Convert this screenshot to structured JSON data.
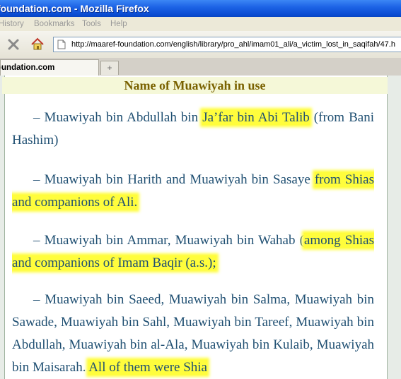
{
  "window": {
    "title": "foundation.com - Mozilla Firefox"
  },
  "menu": {
    "items": [
      "History",
      "Bookmarks",
      "Tools",
      "Help"
    ]
  },
  "toolbar": {
    "url": "http://maaref-foundation.com/english/library/pro_ahl/imam01_ali/a_victim_lost_in_saqifah/47.h",
    "stop_icon": "close-icon",
    "home_icon": "home-icon"
  },
  "tabs": {
    "active_label": "oundation.com",
    "new_tab_label": "+"
  },
  "content": {
    "heading": "Name of Muawiyah in use",
    "paragraphs": [
      {
        "before": "– Muawiyah bin Abdullah bin ",
        "highlight": "Ja’far bin Abi Talib",
        "after": " (from Bani Hashim)"
      },
      {
        "before": "– Muawiyah bin Harith and Muawiyah bin Sasaye ",
        "highlight": "from Shias and companions of Ali.",
        "after": ""
      },
      {
        "before": "– Muawiyah bin Ammar, Muawiyah bin Wahab (",
        "highlight": "among Shias and companions of Imam Baqir (a.s.);",
        "after": ""
      },
      {
        "before": "– Muawiyah bin Saeed, Muawiyah bin Salma, Muawiyah bin Sawade, Muawiyah bin Sahl, Muawiyah bin Tareef, Muawiyah bin Abdullah, Muawiyah bin al-Ala, Muawiyah bin Kulaib, Muawiyah bin Maisarah. ",
        "highlight": "All of them were Shia",
        "after": ""
      }
    ]
  },
  "colors": {
    "highlight": "#fffd3c",
    "body_text": "#1f4f72",
    "heading_text": "#7a6200",
    "heading_bg": "#f5f8d8"
  }
}
